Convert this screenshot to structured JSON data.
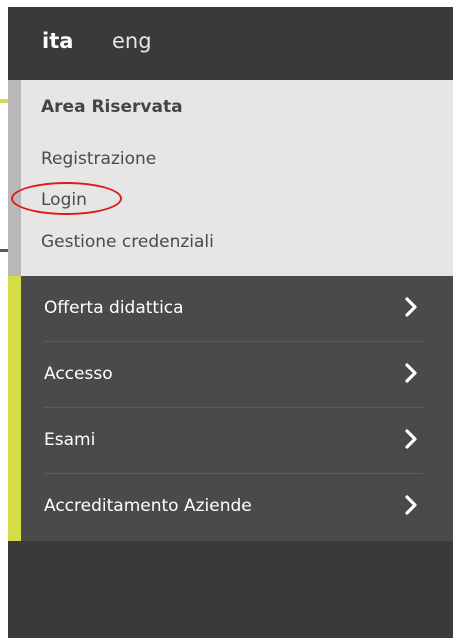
{
  "languages": {
    "active": "ita",
    "other": "eng"
  },
  "reserved_area": {
    "title": "Area Riservata",
    "items": [
      "Registrazione",
      "Login",
      "Gestione credenziali"
    ],
    "highlighted": "Login"
  },
  "menu": {
    "items": [
      {
        "label": "Offerta didattica",
        "icon": "chevron-right-icon"
      },
      {
        "label": "Accesso",
        "icon": "chevron-right-icon"
      },
      {
        "label": "Esami",
        "icon": "chevron-right-icon"
      },
      {
        "label": "Accreditamento Aziende",
        "icon": "chevron-right-icon"
      }
    ]
  },
  "colors": {
    "panel": "#3a3a3a",
    "reserved_bg": "#e6e6e6",
    "menu_bg": "#4a4a4a",
    "accent": "#d6dc45",
    "highlight_circle": "#e01818"
  }
}
